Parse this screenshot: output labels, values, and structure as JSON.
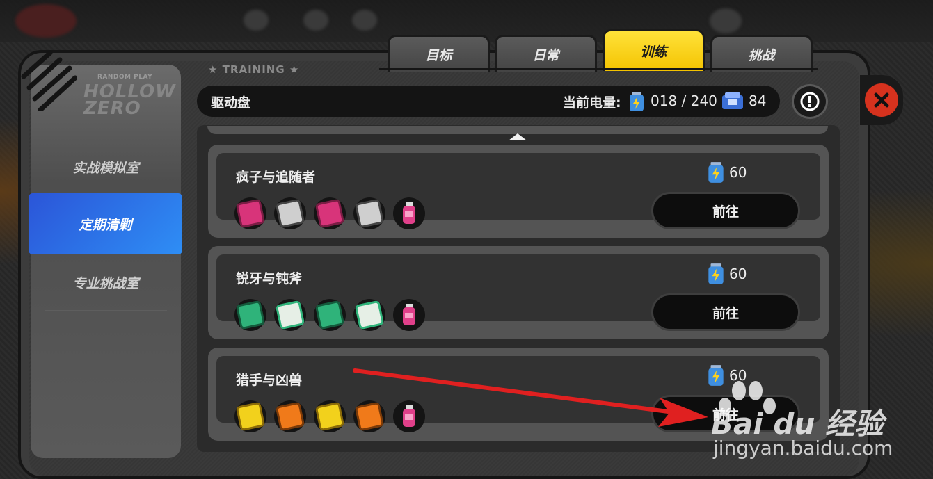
{
  "sidebar": {
    "logo_top": "RANDOM PLAY",
    "logo_word": "HOLLOW ZERO",
    "items": [
      {
        "label": "实战模拟室",
        "active": false
      },
      {
        "label": "定期清剿",
        "active": true
      },
      {
        "label": "专业挑战室",
        "active": false
      }
    ]
  },
  "tabs": [
    {
      "label": "目标",
      "active": false
    },
    {
      "label": "日常",
      "active": false
    },
    {
      "label": "训练",
      "active": true
    },
    {
      "label": "挑战",
      "active": false
    }
  ],
  "section_label": "TRAINING",
  "header": {
    "title": "驱动盘",
    "energy_label": "当前电量:",
    "energy_value": "018 / 240",
    "ticket_value": "84"
  },
  "cards": [
    {
      "title": "疯子与追随者",
      "cost": "60",
      "button": "前往",
      "discs": [
        "#d8347a",
        "#cfcfcf",
        "#d8347a",
        "#cfcfcf"
      ]
    },
    {
      "title": "锐牙与钝斧",
      "cost": "60",
      "button": "前往",
      "discs": [
        "#2fb37a",
        "#e6efe6",
        "#2fb37a",
        "#e6efe6"
      ]
    },
    {
      "title": "猎手与凶兽",
      "cost": "60",
      "button": "前往",
      "discs": [
        "#f2d11c",
        "#f07a1a",
        "#f2d11c",
        "#f07a1a"
      ]
    }
  ],
  "colors": {
    "accent_yellow": "#f4c300",
    "active_blue": "#2e6ff0",
    "arrow_red": "#e02020",
    "close_red": "#d6321e"
  },
  "watermark": {
    "brand": "Bai du 经验",
    "url": "jingyan.baidu.com"
  }
}
